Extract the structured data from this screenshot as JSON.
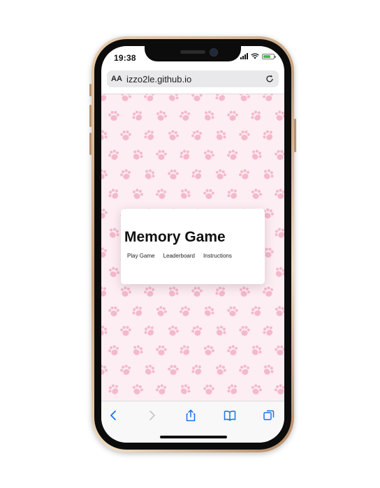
{
  "status_bar": {
    "time": "19:38"
  },
  "browser": {
    "text_size_label": "AA",
    "url": "izzo2le.github.io"
  },
  "page": {
    "title": "Memory Game",
    "nav": [
      "Play Game",
      "Leaderboard",
      "Instructions"
    ]
  },
  "toolbar": {
    "icons": [
      "back-icon",
      "forward-icon",
      "share-icon",
      "bookmarks-icon",
      "tabs-icon"
    ],
    "accent_color": "#1a73e8"
  },
  "theme": {
    "paw_color": "#f4b9cb",
    "background": "#fdeef3"
  }
}
